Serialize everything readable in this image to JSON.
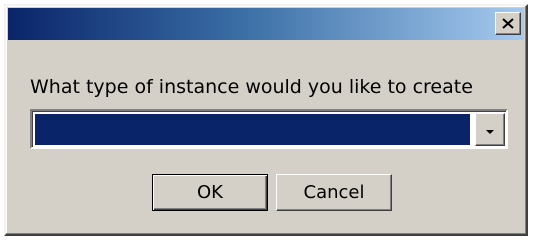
{
  "dialog": {
    "title": "",
    "close_label": "Close",
    "prompt": "What type of instance would you like to create",
    "instance_type": {
      "selected_value": ""
    },
    "ok_label": "OK",
    "cancel_label": "Cancel"
  },
  "colors": {
    "title_gradient_start": "#0a246a",
    "title_gradient_end": "#a6caf0",
    "face": "#d4d0c8",
    "selection": "#0a246a"
  },
  "icons": {
    "close": "close-icon",
    "dropdown": "chevron-down-icon"
  }
}
